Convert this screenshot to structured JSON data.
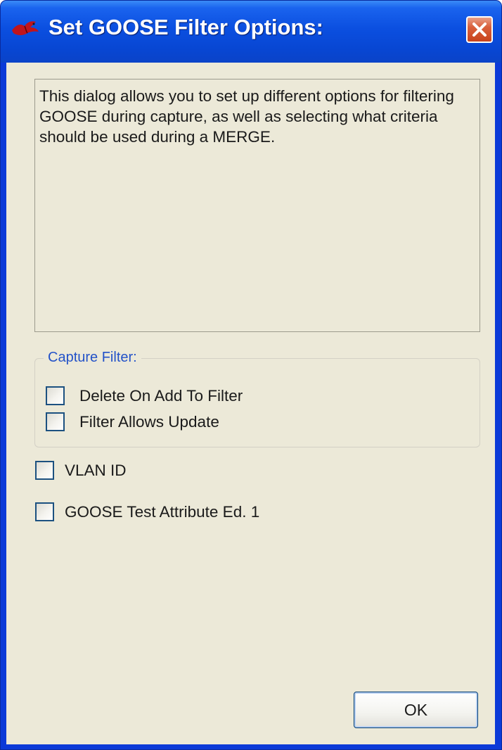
{
  "window": {
    "title": "Set GOOSE Filter Options:",
    "app_icon": "bird-icon",
    "close_icon": "close-icon"
  },
  "description": "This dialog allows you to set up different options for filtering GOOSE during capture, as well as selecting what criteria should be used during a MERGE.",
  "capture_filter": {
    "legend": "Capture Filter:",
    "options": [
      {
        "label": "Delete On Add To Filter",
        "checked": false
      },
      {
        "label": "Filter Allows Update",
        "checked": false
      }
    ]
  },
  "options": [
    {
      "label": "VLAN ID",
      "checked": false
    },
    {
      "label": "GOOSE Test Attribute Ed. 1",
      "checked": false
    }
  ],
  "buttons": {
    "ok_label": "OK"
  },
  "colors": {
    "titlebar": "#0b4fe0",
    "client_background": "#ece9d8",
    "legend_text": "#2352c8",
    "close_button": "#d9603c"
  }
}
